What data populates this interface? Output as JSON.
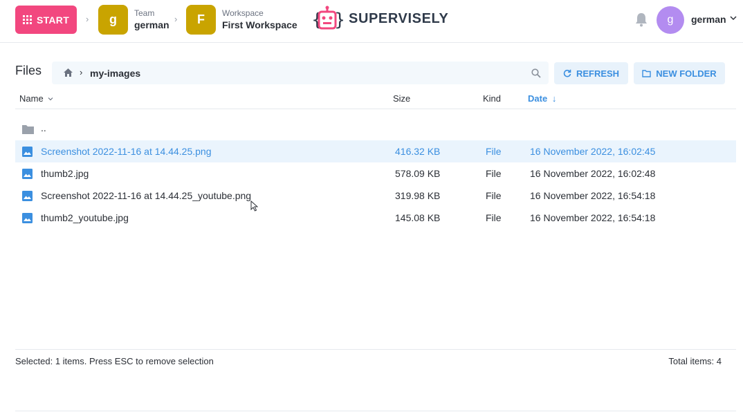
{
  "header": {
    "start_label": "START",
    "team": {
      "letter": "g",
      "label": "Team",
      "name": "german"
    },
    "workspace": {
      "letter": "F",
      "label": "Workspace",
      "name": "First Workspace"
    },
    "logo_text": "SUPERVISELY",
    "user": {
      "letter": "g",
      "name": "german"
    }
  },
  "files": {
    "title": "Files",
    "path": {
      "folder": "my-images"
    },
    "refresh_label": "REFRESH",
    "new_folder_label": "NEW FOLDER",
    "columns": {
      "name": "Name",
      "size": "Size",
      "kind": "Kind",
      "date": "Date"
    },
    "parent_label": "..",
    "rows": [
      {
        "name": "Screenshot 2022-11-16 at 14.44.25.png",
        "size": "416.32 KB",
        "kind": "File",
        "date": "16 November 2022, 16:02:45"
      },
      {
        "name": "thumb2.jpg",
        "size": "578.09 KB",
        "kind": "File",
        "date": "16 November 2022, 16:02:48"
      },
      {
        "name": "Screenshot 2022-11-16 at 14.44.25_youtube.png",
        "size": "319.98 KB",
        "kind": "File",
        "date": "16 November 2022, 16:54:18"
      },
      {
        "name": "thumb2_youtube.jpg",
        "size": "145.08 KB",
        "kind": "File",
        "date": "16 November 2022, 16:54:18"
      }
    ]
  },
  "footer": {
    "selection_text": "Selected: 1 items. Press ESC to remove selection",
    "total_text": "Total items: 4"
  },
  "colors": {
    "accent": "#3b8fe0",
    "start": "#f2477f",
    "team_avatar": "#c9a400",
    "user_avatar": "#b38cf0"
  }
}
